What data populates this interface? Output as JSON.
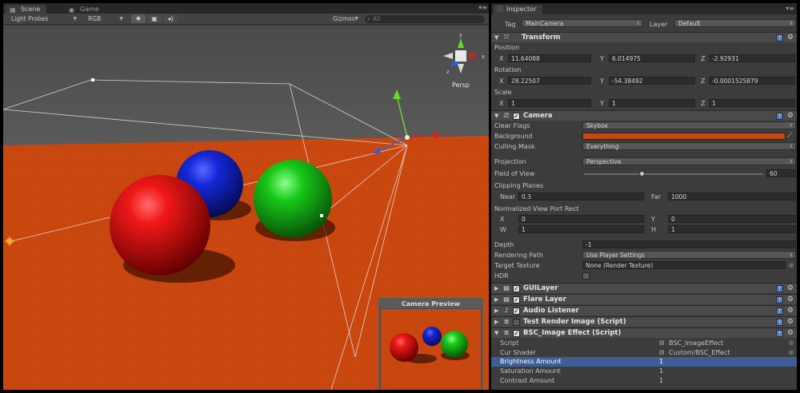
{
  "scene_panel": {
    "tabs": [
      {
        "label": "Scene",
        "icon": "scene-icon"
      },
      {
        "label": "Game",
        "icon": "game-icon"
      }
    ],
    "toolbar": {
      "draw_mode": "Light Probes",
      "render_mode": "RGB",
      "gizmos_label": "Gizmos",
      "search_placeholder": "All"
    },
    "persp_label": "Persp",
    "camera_preview_title": "Camera Preview"
  },
  "inspector": {
    "tab_label": "Inspector",
    "tag_label": "Tag",
    "tag_value": "MainCamera",
    "layer_label": "Layer",
    "layer_value": "Default",
    "transform": {
      "title": "Transform",
      "position_label": "Position",
      "position": {
        "x": "11.64088",
        "y": "6.014975",
        "z": "-2.92931"
      },
      "rotation_label": "Rotation",
      "rotation": {
        "x": "28.22507",
        "y": "-54.38492",
        "z": "-0.0001525879"
      },
      "scale_label": "Scale",
      "scale": {
        "x": "1",
        "y": "1",
        "z": "1"
      },
      "axis_x": "X",
      "axis_y": "Y",
      "axis_z": "Z"
    },
    "camera": {
      "title": "Camera",
      "clear_flags_label": "Clear Flags",
      "clear_flags_value": "Skybox",
      "background_label": "Background",
      "background_color": "#c8470f",
      "culling_mask_label": "Culling Mask",
      "culling_mask_value": "Everything",
      "projection_label": "Projection",
      "projection_value": "Perspective",
      "fov_label": "Field of View",
      "fov_value": "60",
      "clipping_label": "Clipping Planes",
      "near_label": "Near",
      "near_value": "0.3",
      "far_label": "Far",
      "far_value": "1000",
      "viewport_label": "Normalized View Port Rect",
      "vp_x_label": "X",
      "vp_x": "0",
      "vp_y_label": "Y",
      "vp_y": "0",
      "vp_w_label": "W",
      "vp_w": "1",
      "vp_h_label": "H",
      "vp_h": "1",
      "depth_label": "Depth",
      "depth_value": "-1",
      "rendering_path_label": "Rendering Path",
      "rendering_path_value": "Use Player Settings",
      "target_texture_label": "Target Texture",
      "target_texture_value": "None (Render Texture)",
      "hdr_label": "HDR"
    },
    "components": [
      {
        "title": "GUILayer"
      },
      {
        "title": "Flare Layer"
      },
      {
        "title": "Audio Listener"
      },
      {
        "title": "Test Render Image (Script)"
      },
      {
        "title": "BSC_Image Effect (Script)"
      }
    ],
    "bsc": {
      "script_label": "Script",
      "script_value": "BSC_ImageEffect",
      "shader_label": "Cur Shader",
      "shader_value": "Custom/BSC_Effect",
      "brightness_label": "Brightness Amount",
      "brightness_value": "1",
      "saturation_label": "Saturation Amount",
      "saturation_value": "1",
      "contrast_label": "Contrast Amount",
      "contrast_value": "1"
    }
  },
  "colors": {
    "ground": "#c8470f",
    "sphere_red": "#e01414",
    "sphere_blue": "#1428d8",
    "sphere_green": "#18c818",
    "selection": "#3e5f96"
  }
}
